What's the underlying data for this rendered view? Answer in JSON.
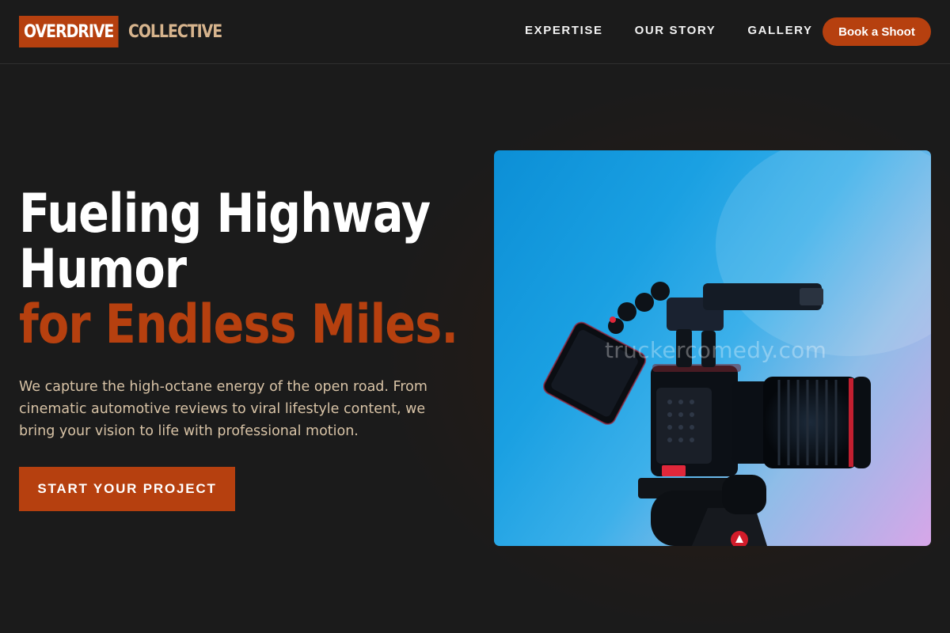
{
  "brand": {
    "logo_primary": "OVERDRIVE",
    "logo_secondary": "COLLECTIVE"
  },
  "nav": {
    "items": [
      {
        "label": "EXPERTISE"
      },
      {
        "label": "OUR STORY"
      },
      {
        "label": "GALLERY"
      }
    ],
    "cta_label": "Book a Shoot"
  },
  "hero": {
    "headline_line1": "Fueling Highway",
    "headline_line2": "Humor",
    "headline_line3": "for Endless Miles.",
    "lead_lines": [
      "We capture the high-octane energy of the open road. From",
      "cinematic automotive reviews to viral lifestyle content, we",
      "bring your vision to life with professional motion."
    ],
    "cta_label": "START YOUR PROJECT",
    "watermark": "truckercomedy.com"
  },
  "colors": {
    "background": "#1b1b1b",
    "accent": "#b6400f",
    "logo_secondary": "#d7b48d",
    "lead_text": "#d8c3a6"
  }
}
